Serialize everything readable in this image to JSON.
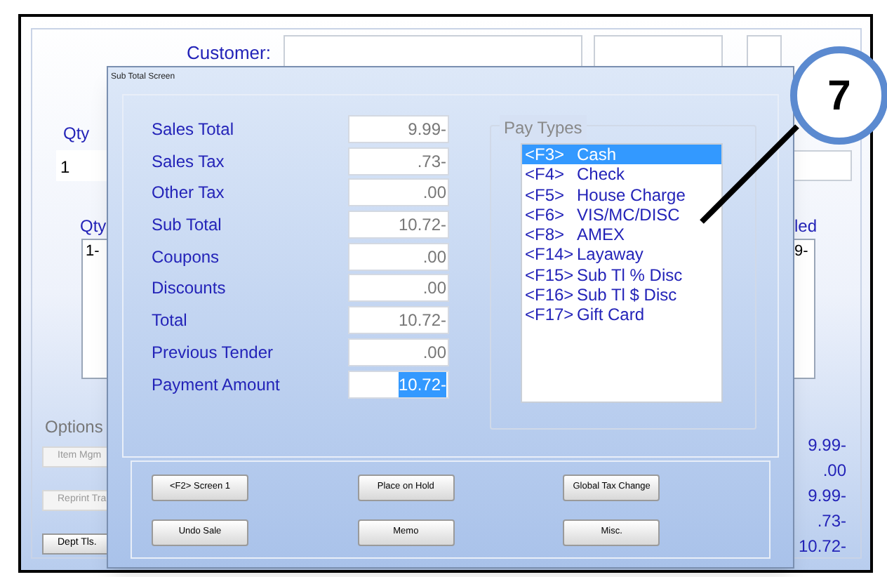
{
  "background": {
    "customer_label": "Customer:",
    "qty_label": "Qty",
    "qty_value": "1",
    "items_header": "Qty",
    "items_list": [
      "1-"
    ],
    "filled_header": "led",
    "filled_list": [
      "9-"
    ],
    "options_title": "Options",
    "option_buttons": [
      "Item Mgm",
      "Reprint Tra",
      "Dept Tls."
    ],
    "totals": [
      "9.99-",
      ".00",
      "9.99-",
      ".73-",
      "10.72-"
    ]
  },
  "dialog": {
    "title": "Sub Total Screen",
    "fields": [
      {
        "label": "Sales Total",
        "value": "9.99-",
        "selected": false
      },
      {
        "label": "Sales Tax",
        "value": ".73-",
        "selected": false
      },
      {
        "label": "Other Tax",
        "value": ".00",
        "selected": false
      },
      {
        "label": "Sub Total",
        "value": "10.72-",
        "selected": false
      },
      {
        "label": "Coupons",
        "value": ".00",
        "selected": false
      },
      {
        "label": "Discounts",
        "value": ".00",
        "selected": false
      },
      {
        "label": "Total",
        "value": "10.72-",
        "selected": false
      },
      {
        "label": "Previous Tender",
        "value": ".00",
        "selected": false
      },
      {
        "label": "Payment Amount",
        "value": "10.72-",
        "selected": true
      }
    ],
    "pay_types": {
      "title": "Pay Types",
      "items": [
        {
          "key": "<F3>",
          "label": "Cash",
          "selected": true
        },
        {
          "key": "<F4>",
          "label": "Check",
          "selected": false
        },
        {
          "key": "<F5>",
          "label": "House Charge",
          "selected": false
        },
        {
          "key": "<F6>",
          "label": "VIS/MC/DISC",
          "selected": false
        },
        {
          "key": "<F8>",
          "label": "AMEX",
          "selected": false
        },
        {
          "key": "<F14>",
          "label": "Layaway",
          "selected": false
        },
        {
          "key": "<F15>",
          "label": "Sub Tl % Disc",
          "selected": false
        },
        {
          "key": "<F16>",
          "label": "Sub Tl $ Disc",
          "selected": false
        },
        {
          "key": "<F17>",
          "label": "Gift Card",
          "selected": false
        }
      ]
    },
    "buttons": [
      "<F2> Screen 1",
      "Place on Hold",
      "Global Tax Change",
      "Undo Sale",
      "Memo",
      "Misc."
    ]
  },
  "callout": "7"
}
